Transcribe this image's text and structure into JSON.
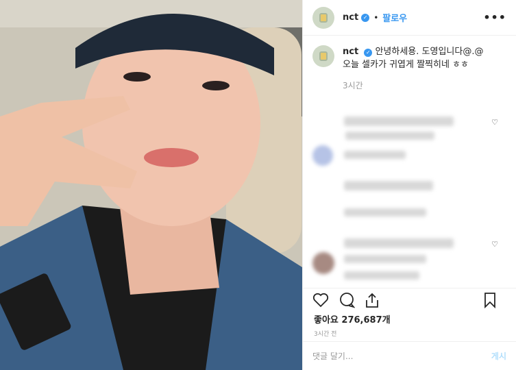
{
  "header": {
    "username": "nct",
    "verified_icon": "verified-badge-icon",
    "separator": "•",
    "follow_label": "팔로우",
    "more_label": "•••"
  },
  "caption": {
    "username": "nct",
    "line1": "안녕하세용. 도영입니다@.@",
    "line2": "오늘 셀카가 귀엽게 짤찍히네 ㅎㅎ",
    "time": "3시간"
  },
  "actions": {
    "like_icon": "heart-icon",
    "comment_icon": "comment-icon",
    "share_icon": "share-icon",
    "save_icon": "bookmark-icon"
  },
  "likes": {
    "label": "좋아요",
    "count": "276,687개"
  },
  "timestamp": "3시간 전",
  "comment_input": {
    "placeholder": "댓글 달기...",
    "post_label": "게시"
  },
  "colors": {
    "accent": "#3897f0",
    "muted": "#999999",
    "post_disabled": "#b2dffc"
  }
}
